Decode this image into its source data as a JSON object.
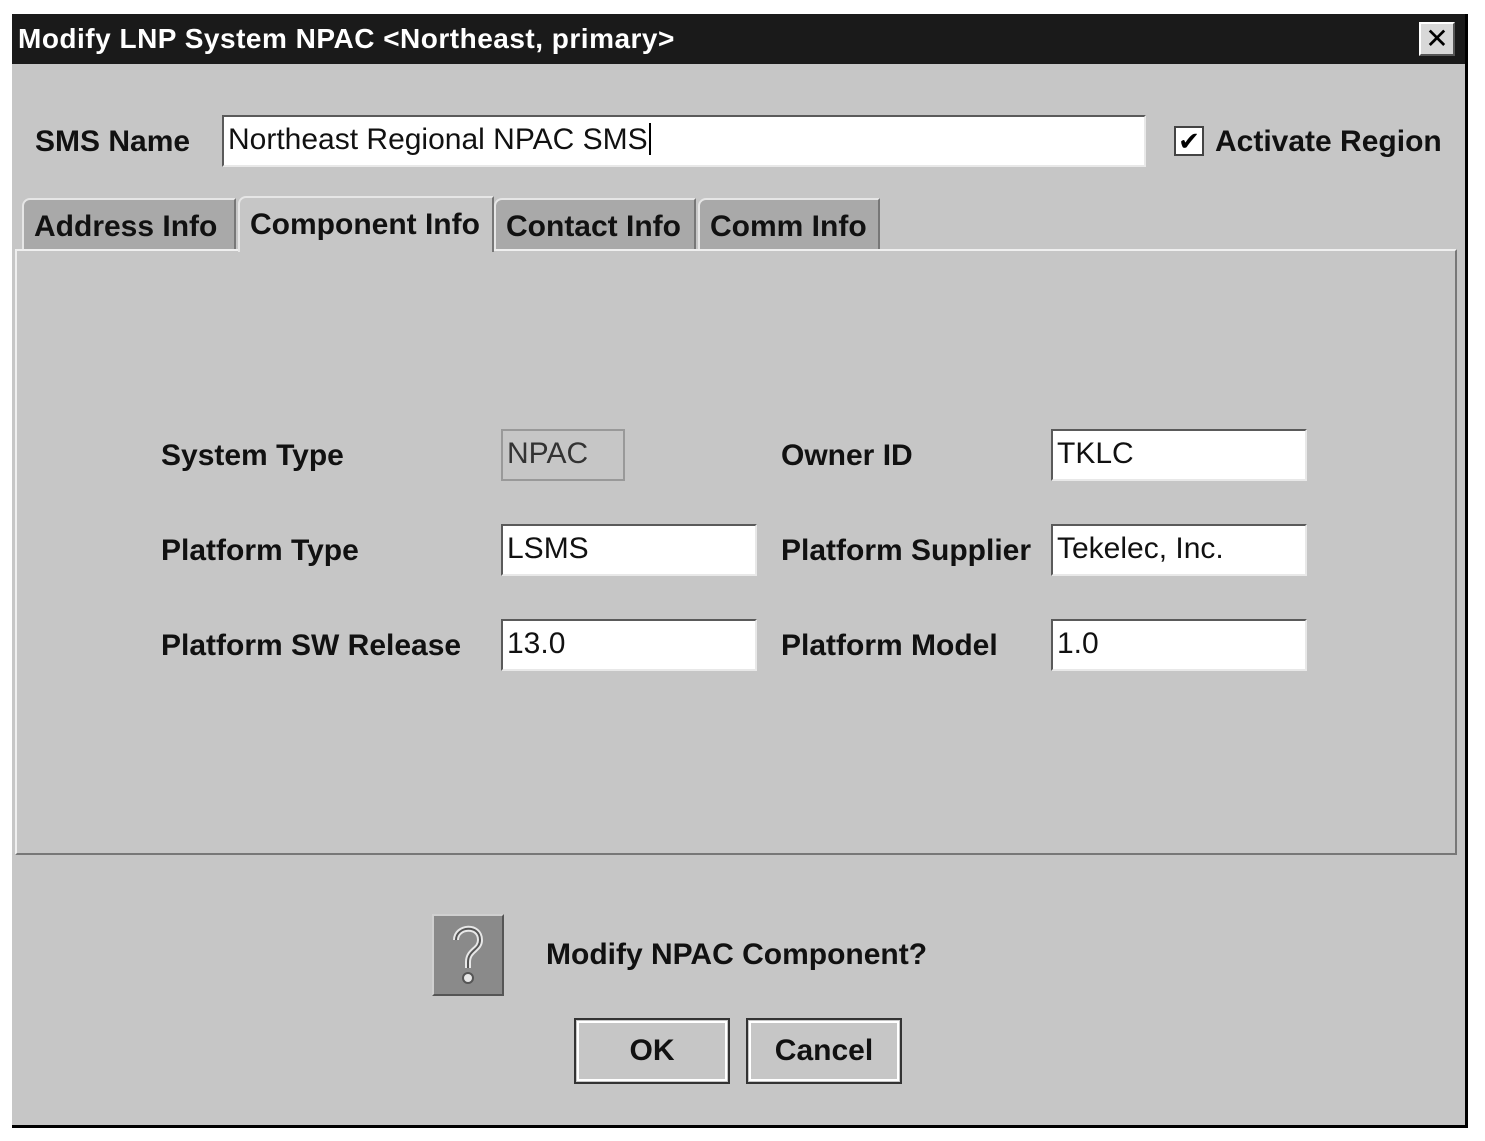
{
  "window": {
    "title": "Modify LNP System NPAC <Northeast,  primary>",
    "close_label": "✕"
  },
  "sms": {
    "label": "SMS Name",
    "value": "Northeast Regional NPAC SMS"
  },
  "activate_region": {
    "label": "Activate Region",
    "checked": true,
    "check_glyph": "✔"
  },
  "tabs": [
    {
      "label": "Address Info",
      "active": false
    },
    {
      "label": "Component Info",
      "active": true
    },
    {
      "label": "Contact Info",
      "active": false
    },
    {
      "label": "Comm Info",
      "active": false
    }
  ],
  "component": {
    "system_type": {
      "label": "System Type",
      "value": "NPAC"
    },
    "owner_id": {
      "label": "Owner ID",
      "value": "TKLC"
    },
    "platform_type": {
      "label": "Platform Type",
      "value": "LSMS"
    },
    "platform_supplier": {
      "label": "Platform Supplier",
      "value": "Tekelec, Inc."
    },
    "platform_sw_release": {
      "label": "Platform SW Release",
      "value": "13.0"
    },
    "platform_model": {
      "label": "Platform Model",
      "value": "1.0"
    }
  },
  "confirm": {
    "icon": "question-icon",
    "question": "Modify NPAC Component?",
    "ok_label": "OK",
    "cancel_label": "Cancel"
  }
}
